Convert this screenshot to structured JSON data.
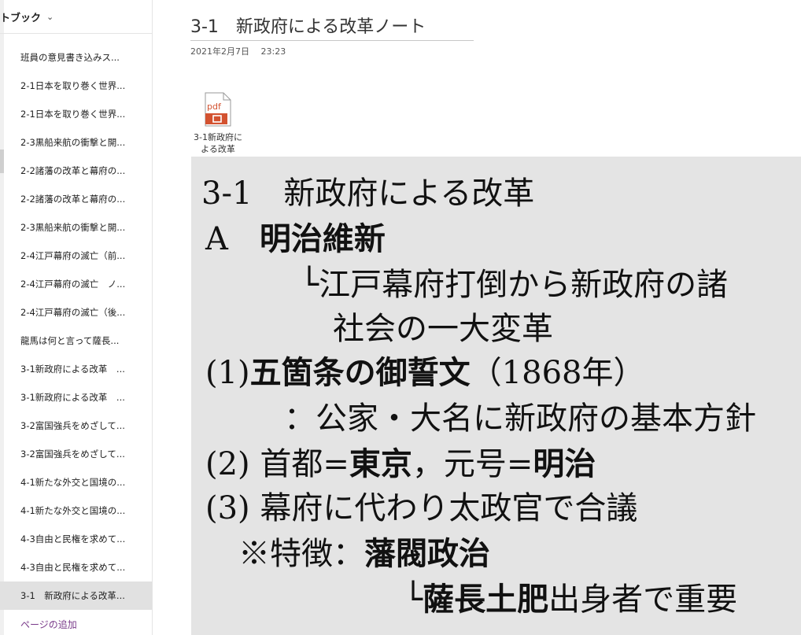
{
  "sidebar": {
    "section_title": "トブック",
    "pages": [
      "班員の意見書き込みス...",
      "2-1日本を取り巻く世界...",
      "2-1日本を取り巻く世界...",
      "2-3黒船来航の衝撃と開...",
      "2-2諸藩の改革と幕府の...",
      "2-2諸藩の改革と幕府の...",
      "2-3黒船来航の衝撃と開...",
      "2-4江戸幕府の滅亡（前...",
      "2-4江戸幕府の滅亡　ノ...",
      "2-4江戸幕府の滅亡（後...",
      "龍馬は何と言って薩長...",
      "3-1新政府による改革　...",
      "3-1新政府による改革　...",
      "3-2富国強兵をめざして...",
      "3-2富国強兵をめざして...",
      "4-1新たな外交と国境の...",
      "4-1新たな外交と国境の...",
      "4-3自由と民権を求めて...",
      "4-3自由と民権を求めて...",
      "3-1　新政府による改革..."
    ],
    "selected_index": 19,
    "add_page_label": "ページの追加"
  },
  "page": {
    "title": "3-1　新政府による改革ノート",
    "date": "2021年2月7日　 23:23"
  },
  "attachment": {
    "icon_label": "pdf",
    "file_name": "3-1新政府による改革",
    "accent_color": "#d35230"
  },
  "printout": {
    "l1": "3-1　新政府による改革",
    "l2a": "A　",
    "l2b": "明治維新",
    "l3": "└江戸幕府打倒から新政府の諸",
    "l4": "社会の一大変革",
    "l5a": "(1)",
    "l5b": "五箇条の御誓文",
    "l5c": "（1868年）",
    "l6": "：公家・大名に新政府の基本方針",
    "l7a": "(2) 首都=",
    "l7b": "東京",
    "l7c": "，元号=",
    "l7d": "明治",
    "l8": "(3) 幕府に代わり太政官で合議",
    "l9a": "※特徴：",
    "l9b": "藩閥政治",
    "l10a": "└",
    "l10b": "薩長土肥",
    "l10c": "出身者で重要"
  }
}
